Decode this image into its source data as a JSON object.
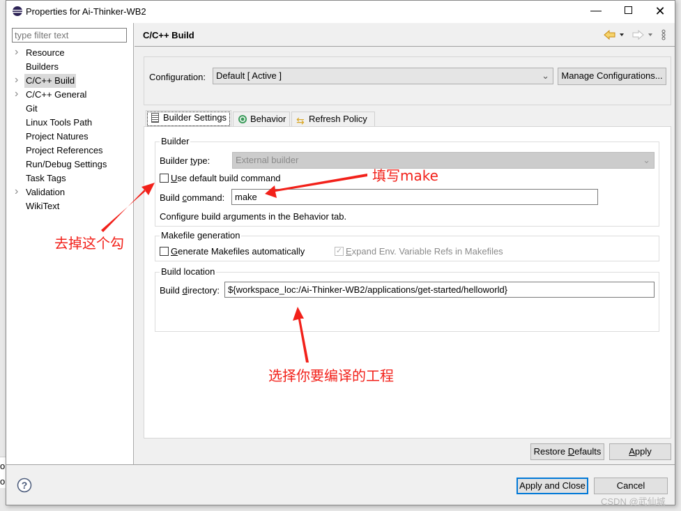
{
  "background_window": {
    "line1": "o",
    "line2": "or"
  },
  "window": {
    "title": "Properties for Ai-Thinker-WB2",
    "controls": [
      "minimize-icon",
      "maximize-icon",
      "close-icon"
    ]
  },
  "sidebar": {
    "filter_placeholder": "type filter text",
    "items": [
      {
        "label": "Resource",
        "expandable": true
      },
      {
        "label": "Builders",
        "expandable": false
      },
      {
        "label": "C/C++ Build",
        "expandable": true,
        "selected": true
      },
      {
        "label": "C/C++ General",
        "expandable": true
      },
      {
        "label": "Git",
        "expandable": false
      },
      {
        "label": "Linux Tools Path",
        "expandable": false
      },
      {
        "label": "Project Natures",
        "expandable": false
      },
      {
        "label": "Project References",
        "expandable": false
      },
      {
        "label": "Run/Debug Settings",
        "expandable": false
      },
      {
        "label": "Task Tags",
        "expandable": false
      },
      {
        "label": "Validation",
        "expandable": true
      },
      {
        "label": "WikiText",
        "expandable": false
      }
    ]
  },
  "header": {
    "title": "C/C++ Build",
    "nav_icons": [
      "back-arrow-icon",
      "back-dropdown-icon",
      "forward-arrow-icon",
      "forward-dropdown-icon",
      "view-menu-icon"
    ]
  },
  "configuration": {
    "label": "Configuration:",
    "value": "Default  [ Active ]",
    "manage_button": "Manage Configurations..."
  },
  "tabs": [
    {
      "label": "Builder Settings",
      "icon": "builder-settings-icon",
      "active": true
    },
    {
      "label": "Behavior",
      "icon": "behavior-icon",
      "active": false
    },
    {
      "label": "Refresh Policy",
      "icon": "refresh-policy-icon",
      "active": false
    }
  ],
  "builder": {
    "group_label": "Builder",
    "type_label": "Builder type:",
    "type_value": "External builder",
    "use_default_label": "Use default build command",
    "use_default_checked": false,
    "command_label": "Build command:",
    "command_value": "make",
    "hint": "Configure build arguments in the Behavior tab."
  },
  "makefile": {
    "group_label": "Makefile generation",
    "generate_label": "Generate Makefiles automatically",
    "generate_checked": false,
    "expand_label": "Expand Env. Variable Refs in Makefiles",
    "expand_checked": true,
    "expand_disabled": true
  },
  "location": {
    "group_label": "Build location",
    "directory_label": "Build directory:",
    "directory_value": "${workspace_loc:/Ai-Thinker-WB2/applications/get-started/helloworld}"
  },
  "buttons": {
    "restore_defaults": "Restore Defaults",
    "apply": "Apply",
    "apply_and_close": "Apply and Close",
    "cancel": "Cancel"
  },
  "annotations": {
    "uncheck": "去掉这个勾",
    "fill_make": "填写make",
    "choose_project": "选择你要编译的工程",
    "color": "#f2211a"
  },
  "watermark": "CSDN @武仙城"
}
